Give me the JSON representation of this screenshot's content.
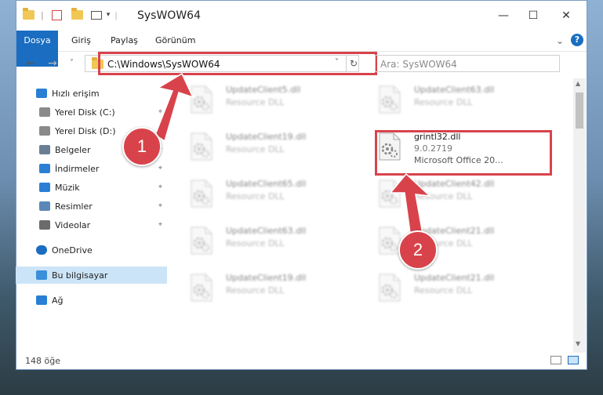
{
  "window": {
    "title": "SysWOW64",
    "minimize_glyph": "—",
    "maximize_glyph": "☐",
    "close_glyph": "✕"
  },
  "ribbon": {
    "tabs": [
      "Dosya",
      "Giriş",
      "Paylaş",
      "Görünüm"
    ],
    "expand_glyph": "⌄",
    "help_glyph": "?"
  },
  "nav": {
    "back_glyph": "←",
    "forward_glyph": "→",
    "recent_glyph": "˅",
    "up_glyph": "↑",
    "address": "C:\\Windows\\SysWOW64",
    "address_drop_glyph": "˅",
    "refresh_glyph": "↻",
    "search_placeholder": "Ara: SysWOW64"
  },
  "sidebar": {
    "items": [
      {
        "label": "Hızlı erişim",
        "icon": "star-icon",
        "pinned": false
      },
      {
        "label": "Yerel Disk (C:)",
        "icon": "drive-icon",
        "pinned": true
      },
      {
        "label": "Yerel Disk (D:)",
        "icon": "drive-icon",
        "pinned": true
      },
      {
        "label": "Belgeler",
        "icon": "documents-icon",
        "pinned": true
      },
      {
        "label": "İndirmeler",
        "icon": "download-icon",
        "pinned": true
      },
      {
        "label": "Müzik",
        "icon": "music-icon",
        "pinned": true
      },
      {
        "label": "Resimler",
        "icon": "pictures-icon",
        "pinned": true
      },
      {
        "label": "Videolar",
        "icon": "videos-icon",
        "pinned": true
      },
      {
        "label": "OneDrive",
        "icon": "cloud-icon",
        "pinned": false
      },
      {
        "label": "Bu bilgisayar",
        "icon": "computer-icon",
        "pinned": false
      },
      {
        "label": "Ağ",
        "icon": "network-icon",
        "pinned": false
      }
    ],
    "pin_glyph": "⌖"
  },
  "files": [
    {
      "name": "UpdateClient5.dll",
      "desc": "Resource DLL",
      "highlight": false
    },
    {
      "name": "UpdateClient63.dll",
      "desc": "Resource DLL",
      "highlight": false
    },
    {
      "name": "UpdateClient19.dll",
      "desc": "Resource DLL",
      "highlight": false
    },
    {
      "name": "grintl32.dll",
      "version": "9.0.2719",
      "desc": "Microsoft Office 20...",
      "highlight": true
    },
    {
      "name": "UpdateClient65.dll",
      "desc": "Resource DLL",
      "highlight": false
    },
    {
      "name": "UpdateClient42.dll",
      "desc": "Resource DLL",
      "highlight": false
    },
    {
      "name": "UpdateClient63.dll",
      "desc": "Resource DLL",
      "highlight": false
    },
    {
      "name": "UpdateClient21.dll",
      "desc": "Resource DLL",
      "highlight": false
    },
    {
      "name": "UpdateClient19.dll",
      "desc": "Resource DLL",
      "highlight": false
    },
    {
      "name": "UpdateClient21.dll",
      "desc": "Resource DLL",
      "highlight": false
    }
  ],
  "status": {
    "count": "148 öğe"
  },
  "annotations": {
    "step1": "1",
    "step2": "2",
    "color": "#d8434b"
  }
}
